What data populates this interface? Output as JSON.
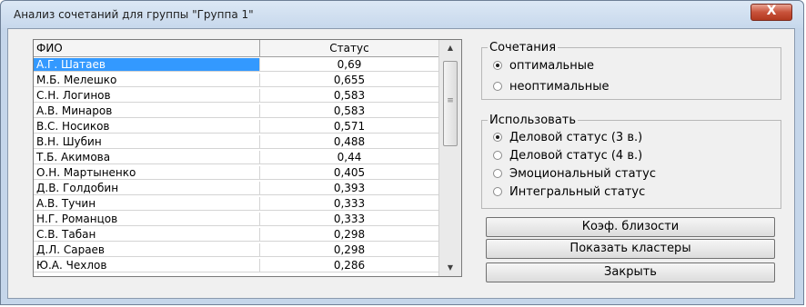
{
  "window": {
    "title": "Анализ сочетаний для группы \"Группа 1\"",
    "close_label": "X"
  },
  "table": {
    "columns": [
      "ФИО",
      "Статус"
    ],
    "rows": [
      {
        "name": "А.Г. Шатаев",
        "status": "0,69"
      },
      {
        "name": "М.Б. Мелешко",
        "status": "0,655"
      },
      {
        "name": "С.Н. Логинов",
        "status": "0,583"
      },
      {
        "name": "А.В. Минаров",
        "status": "0,583"
      },
      {
        "name": "В.С. Носиков",
        "status": "0,571"
      },
      {
        "name": "В.Н. Шубин",
        "status": "0,488"
      },
      {
        "name": "Т.Б. Акимова",
        "status": "0,44"
      },
      {
        "name": "О.Н. Мартыненко",
        "status": "0,405"
      },
      {
        "name": "Д.В. Голдобин",
        "status": "0,393"
      },
      {
        "name": "А.В. Тучин",
        "status": "0,333"
      },
      {
        "name": "Н.Г. Романцов",
        "status": "0,333"
      },
      {
        "name": "С.В. Табан",
        "status": "0,298"
      },
      {
        "name": "Д.Л. Сараев",
        "status": "0,298"
      },
      {
        "name": "Ю.А. Чехлов",
        "status": "0,286"
      }
    ],
    "selected_row": 0
  },
  "combinations": {
    "legend": "Сочетания",
    "options": [
      {
        "label": "оптимальные",
        "checked": true
      },
      {
        "label": "неоптимальные",
        "checked": false
      }
    ]
  },
  "use": {
    "legend": "Использовать",
    "options": [
      {
        "label": "Деловой статус (3 в.)",
        "checked": true
      },
      {
        "label": "Деловой статус (4 в.)",
        "checked": false
      },
      {
        "label": "Эмоциональный статус",
        "checked": false
      },
      {
        "label": "Интегральный статус",
        "checked": false
      }
    ]
  },
  "buttons": {
    "proximity": "Коэф. близости",
    "clusters": "Показать кластеры",
    "close": "Закрыть"
  }
}
